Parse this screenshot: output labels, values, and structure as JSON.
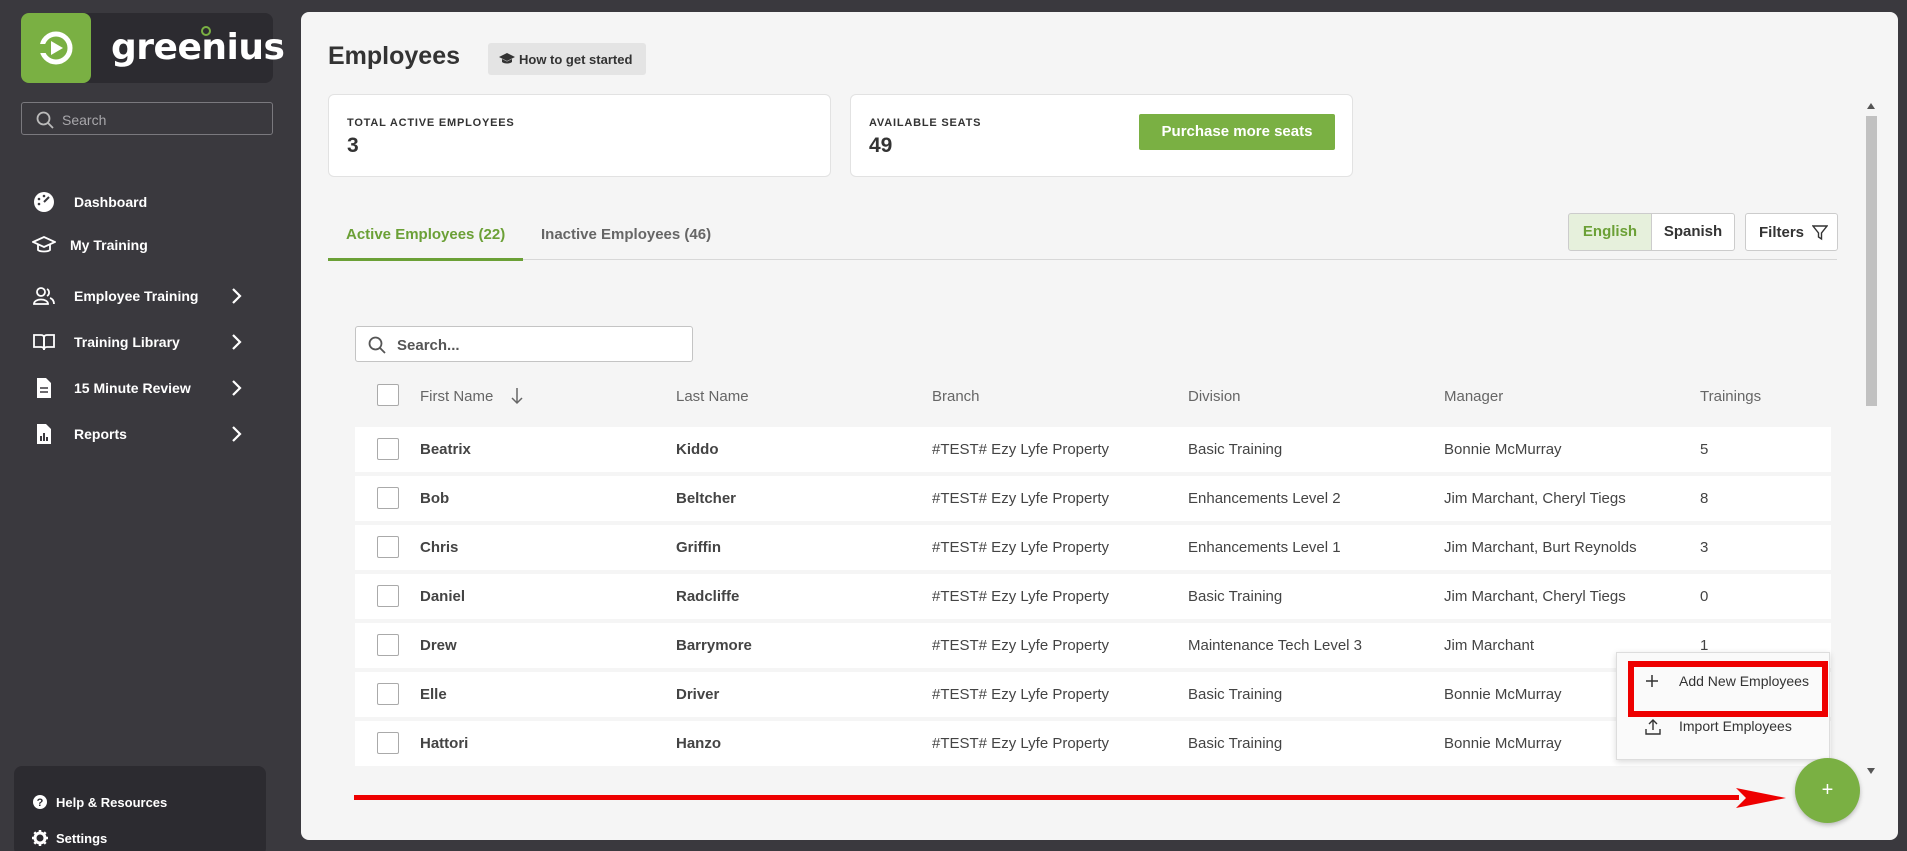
{
  "brand": {
    "name": "greenius",
    "color": "#7ab043"
  },
  "sidebar": {
    "search_placeholder": "Search",
    "items": [
      {
        "label": "Dashboard",
        "icon": "gauge-icon",
        "has_submenu": false
      },
      {
        "label": "My Training",
        "icon": "graduation-cap-icon",
        "has_submenu": false
      },
      {
        "label": "Employee Training",
        "icon": "users-icon",
        "has_submenu": true
      },
      {
        "label": "Training Library",
        "icon": "book-icon",
        "has_submenu": true
      },
      {
        "label": "15 Minute Review",
        "icon": "document-icon",
        "has_submenu": true
      },
      {
        "label": "Reports",
        "icon": "report-icon",
        "has_submenu": true
      }
    ],
    "footer": [
      {
        "label": "Help & Resources",
        "icon": "help-icon"
      },
      {
        "label": "Settings",
        "icon": "gear-icon"
      }
    ]
  },
  "header": {
    "title": "Employees",
    "howto_label": "How to get started"
  },
  "stats": {
    "total_label": "TOTAL ACTIVE EMPLOYEES",
    "total_value": "3",
    "seats_label": "AVAILABLE SEATS",
    "seats_value": "49",
    "purchase_label": "Purchase more seats"
  },
  "tabs": [
    {
      "label": "Active Employees (22)",
      "active": true
    },
    {
      "label": "Inactive Employees (46)",
      "active": false
    }
  ],
  "language": {
    "options": [
      "English",
      "Spanish"
    ],
    "selected": "English"
  },
  "filters_label": "Filters",
  "table": {
    "search_placeholder": "Search...",
    "columns": [
      "First Name",
      "Last Name",
      "Branch",
      "Division",
      "Manager",
      "Trainings"
    ],
    "sort_column": "First Name",
    "rows": [
      [
        "Beatrix",
        "Kiddo",
        "#TEST# Ezy Lyfe Property",
        "Basic Training",
        "Bonnie McMurray",
        "5"
      ],
      [
        "Bob",
        "Beltcher",
        "#TEST# Ezy Lyfe Property",
        "Enhancements Level 2",
        "Jim Marchant, Cheryl Tiegs",
        "8"
      ],
      [
        "Chris",
        "Griffin",
        "#TEST# Ezy Lyfe Property",
        "Enhancements Level 1",
        "Jim Marchant, Burt Reynolds",
        "3"
      ],
      [
        "Daniel",
        "Radcliffe",
        "#TEST# Ezy Lyfe Property",
        "Basic Training",
        "Jim Marchant, Cheryl Tiegs",
        "0"
      ],
      [
        "Drew",
        "Barrymore",
        "#TEST# Ezy Lyfe Property",
        "Maintenance Tech Level 3",
        "Jim Marchant",
        "1"
      ],
      [
        "Elle",
        "Driver",
        "#TEST# Ezy Lyfe Property",
        "Basic Training",
        "Bonnie McMurray",
        ""
      ],
      [
        "Hattori",
        "Hanzo",
        "#TEST# Ezy Lyfe Property",
        "Basic Training",
        "Bonnie McMurray",
        ""
      ]
    ]
  },
  "popup_menu": {
    "items": [
      {
        "label": "Add New Employees",
        "icon": "plus-icon"
      },
      {
        "label": "Import Employees",
        "icon": "upload-icon"
      }
    ]
  },
  "fab_label": "+"
}
